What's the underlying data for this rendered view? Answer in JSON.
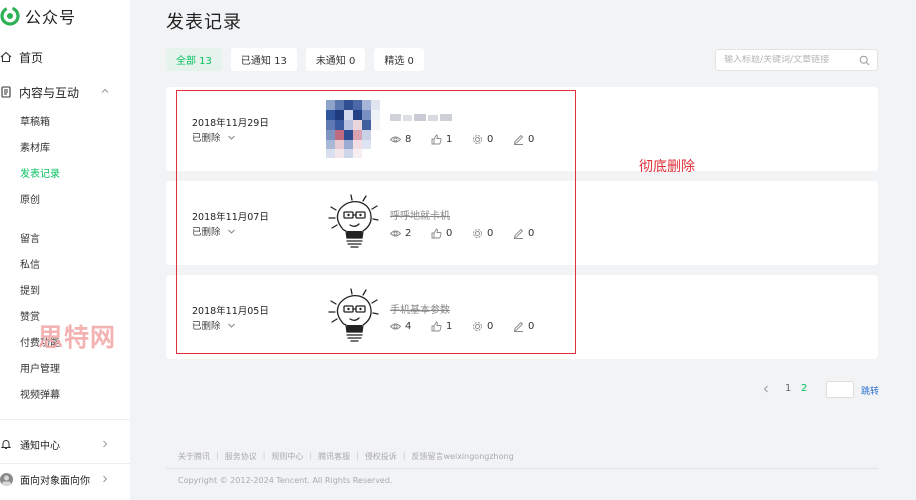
{
  "brand": {
    "name": "公众号"
  },
  "sidebar": {
    "home": "首页",
    "content_group": "内容与互动",
    "content_items": [
      "草稿箱",
      "素材库",
      "发表记录",
      "原创"
    ],
    "interact_items": [
      "留言",
      "私信",
      "提到",
      "赞赏",
      "付费功能",
      "用户管理",
      "视频弹幕"
    ],
    "notify": "通知中心",
    "account": "面向对象面向你"
  },
  "watermark": "思特网",
  "page": {
    "title": "发表记录"
  },
  "tabs": [
    {
      "label": "全部 13",
      "active": true
    },
    {
      "label": "已通知 13",
      "active": false
    },
    {
      "label": "未通知 0",
      "active": false
    },
    {
      "label": "精选 0",
      "active": false
    }
  ],
  "search": {
    "placeholder": "输入标题/关键词/文章链接"
  },
  "records": [
    {
      "date": "2018年11月29日",
      "status": "已删除",
      "title": "",
      "views": "8",
      "likes": "1",
      "shares": "0",
      "comments": "0",
      "thumb": "pixelated-photo"
    },
    {
      "date": "2018年11月07日",
      "status": "已删除",
      "title": "呼呼地就卡机",
      "views": "2",
      "likes": "0",
      "shares": "0",
      "comments": "0",
      "thumb": "lightbulb-doodle"
    },
    {
      "date": "2018年11月05日",
      "status": "已删除",
      "title": "手机基本参数",
      "views": "4",
      "likes": "1",
      "shares": "0",
      "comments": "0",
      "thumb": "lightbulb-doodle"
    }
  ],
  "annotation": "彻底删除",
  "pagination": {
    "page1": "1",
    "page2": "2",
    "input_value": "",
    "jump": "跳转"
  },
  "footer": {
    "links": [
      "关于腾讯",
      "服务协议",
      "规则中心",
      "腾讯客服",
      "侵权投诉",
      "反馈留言weixingongzhong"
    ],
    "copyright": "Copyright © 2012-2024 Tencent. All Rights Reserved."
  },
  "colors": {
    "accent": "#07c160",
    "annotation": "#e0303a",
    "link": "#2a6fd6"
  }
}
